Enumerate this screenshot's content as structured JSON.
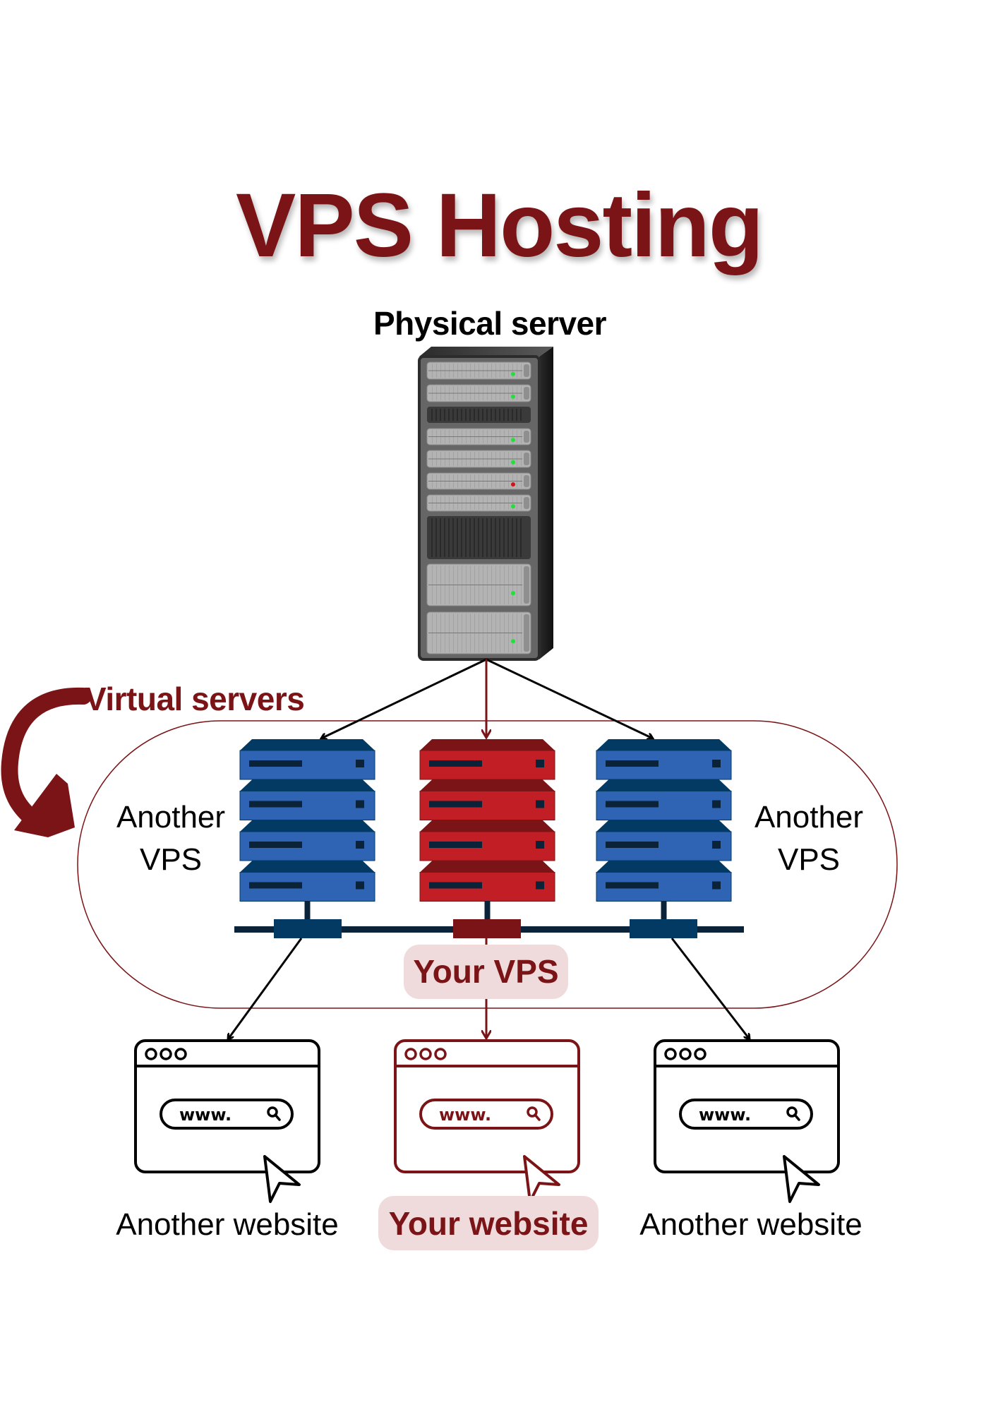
{
  "title": "VPS Hosting",
  "physical_server": {
    "label": "Physical server",
    "icon": "server-rack-icon",
    "status_leds": [
      "green",
      "green",
      "green",
      "green",
      "red",
      "green",
      "green",
      "green"
    ]
  },
  "virtual_servers": {
    "label": "Virtual servers",
    "items": [
      {
        "label_line1": "Another",
        "label_line2": "VPS",
        "color": "#2F64B4",
        "top_color": "#033A63",
        "highlighted": false
      },
      {
        "label": "Your VPS",
        "color": "#C11F25",
        "top_color": "#7B1416",
        "highlighted": true
      },
      {
        "label_line1": "Another",
        "label_line2": "VPS",
        "color": "#2F64B4",
        "top_color": "#033A63",
        "highlighted": false
      }
    ]
  },
  "websites": [
    {
      "label": "Another website",
      "url_text": "www.",
      "highlighted": false,
      "stroke": "#000000"
    },
    {
      "label": "Your website",
      "url_text": "www.",
      "highlighted": true,
      "stroke": "#7B1416"
    },
    {
      "label": "Another website",
      "url_text": "www.",
      "highlighted": false,
      "stroke": "#000000"
    }
  ],
  "colors": {
    "accent": "#7B1416",
    "badge_bg": "#EFDADC",
    "navy": "#0A2338",
    "blue_connector": "#033A63"
  }
}
